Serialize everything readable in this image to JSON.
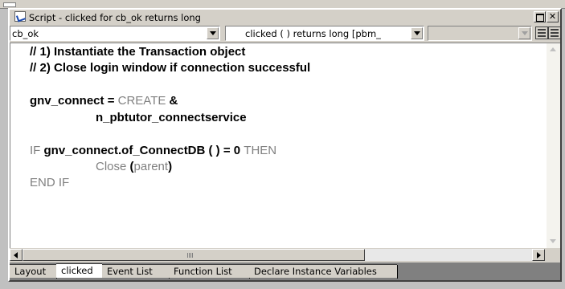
{
  "window": {
    "title": "Script - clicked for cb_ok returns long"
  },
  "toolbar": {
    "object_select": "cb_ok",
    "event_select": "clicked ( )  returns long [pbm_",
    "ancestor_select": ""
  },
  "icons": {
    "window_icon": "script-pencil-icon",
    "maximize": "maximize-icon",
    "close": "close-icon",
    "view_toggle_1": "list-view-icon",
    "view_toggle_2": "list-view-icon"
  },
  "titlebar_buttons": {
    "close_label": "✕"
  },
  "code": {
    "lines": [
      {
        "comment_a": "// 1) Instantiate the Transaction object"
      },
      {
        "comment_b": "// 2) Close login window if connection successful"
      },
      {
        "l3_var": "gnv_connect",
        "l3_eq": " = ",
        "l3_kw": "CREATE",
        "l3_amp": " &"
      },
      {
        "l4": "n_pbtutor_connectservice"
      },
      {
        "l6_kw": "IF ",
        "l6_expr": "gnv_connect.of_ConnectDB ( ) = 0 ",
        "l6_then": "THEN"
      },
      {
        "l7_kw": "Close ",
        "l7_p1": "(",
        "l7_arg": "parent",
        "l7_p2": ")"
      },
      {
        "l8_kw": "END IF"
      }
    ]
  },
  "tabs": [
    "Layout",
    "clicked",
    "Event List",
    "Function List",
    "Declare Instance Variables"
  ],
  "active_tab": "clicked"
}
